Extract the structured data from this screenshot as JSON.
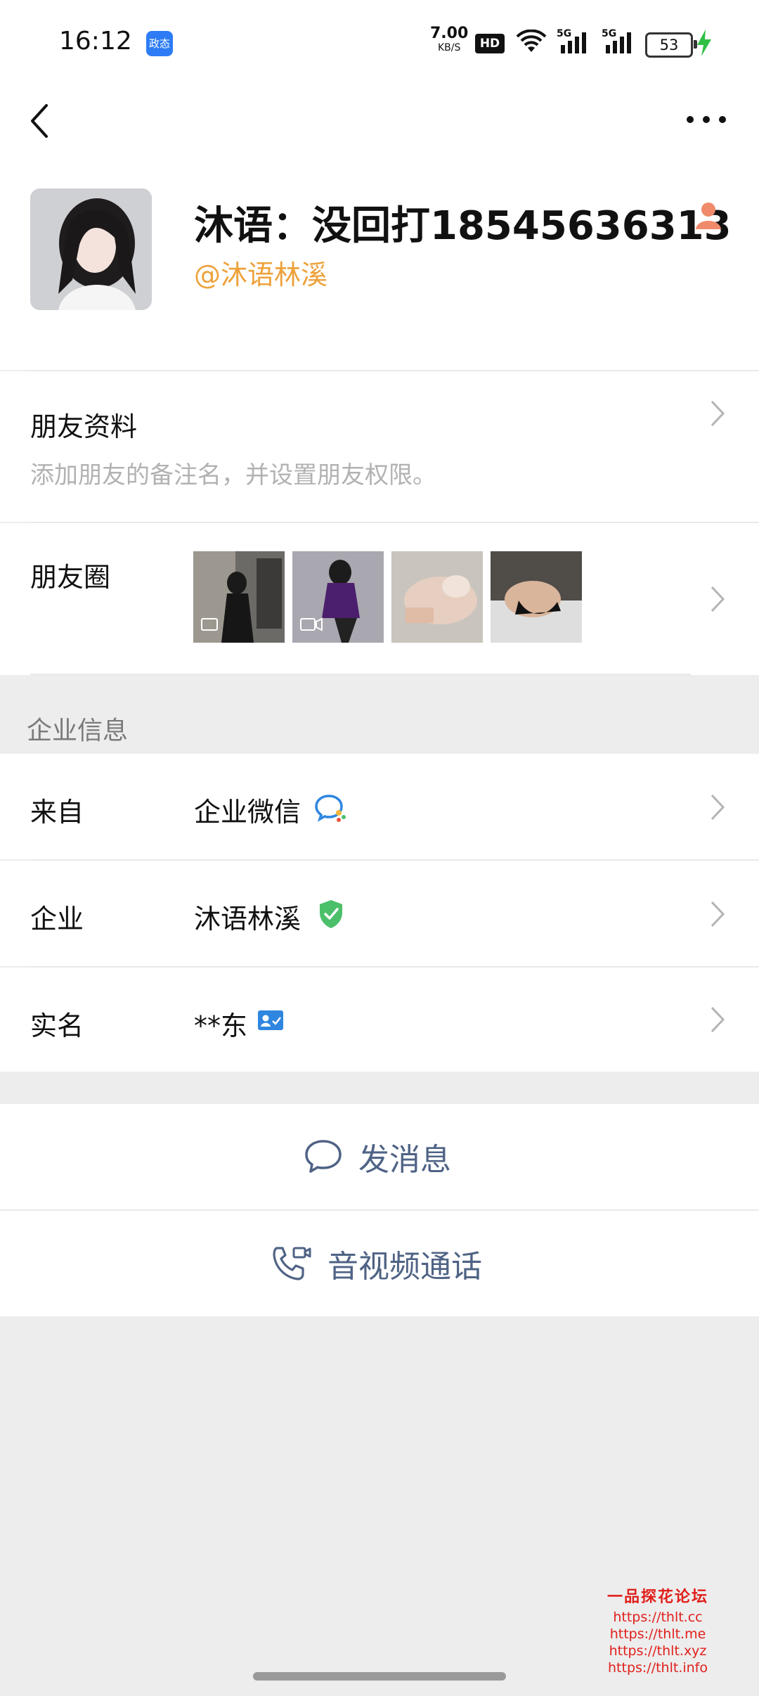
{
  "status_bar": {
    "time": "16:12",
    "app_badge": "政态",
    "net_speed": "7.00",
    "net_unit": "KB/S",
    "hd": "HD",
    "signal1": "5G",
    "signal2": "5G",
    "battery": "53"
  },
  "profile": {
    "name": "沐语：没回打18545636313",
    "handle": "@沐语林溪"
  },
  "friend_info": {
    "title": "朋友资料",
    "subtitle": "添加朋友的备注名，并设置朋友权限。"
  },
  "moments": {
    "label": "朋友圈"
  },
  "enterprise": {
    "section_title": "企业信息",
    "from_label": "来自",
    "from_value": "企业微信",
    "company_label": "企业",
    "company_value": "沐语林溪",
    "realname_label": "实名",
    "realname_value": "**东"
  },
  "actions": {
    "message": "发消息",
    "call": "音视频通话"
  },
  "watermark": {
    "title": "一品探花论坛",
    "lines": [
      "https://thlt.cc",
      "https://thlt.me",
      "https://thlt.xyz",
      "https://thlt.info"
    ]
  },
  "colors": {
    "accent_orange": "#eda23b",
    "action_blue": "#4f6385",
    "verified_green": "#4cbf6a",
    "id_blue": "#2f86e0"
  }
}
